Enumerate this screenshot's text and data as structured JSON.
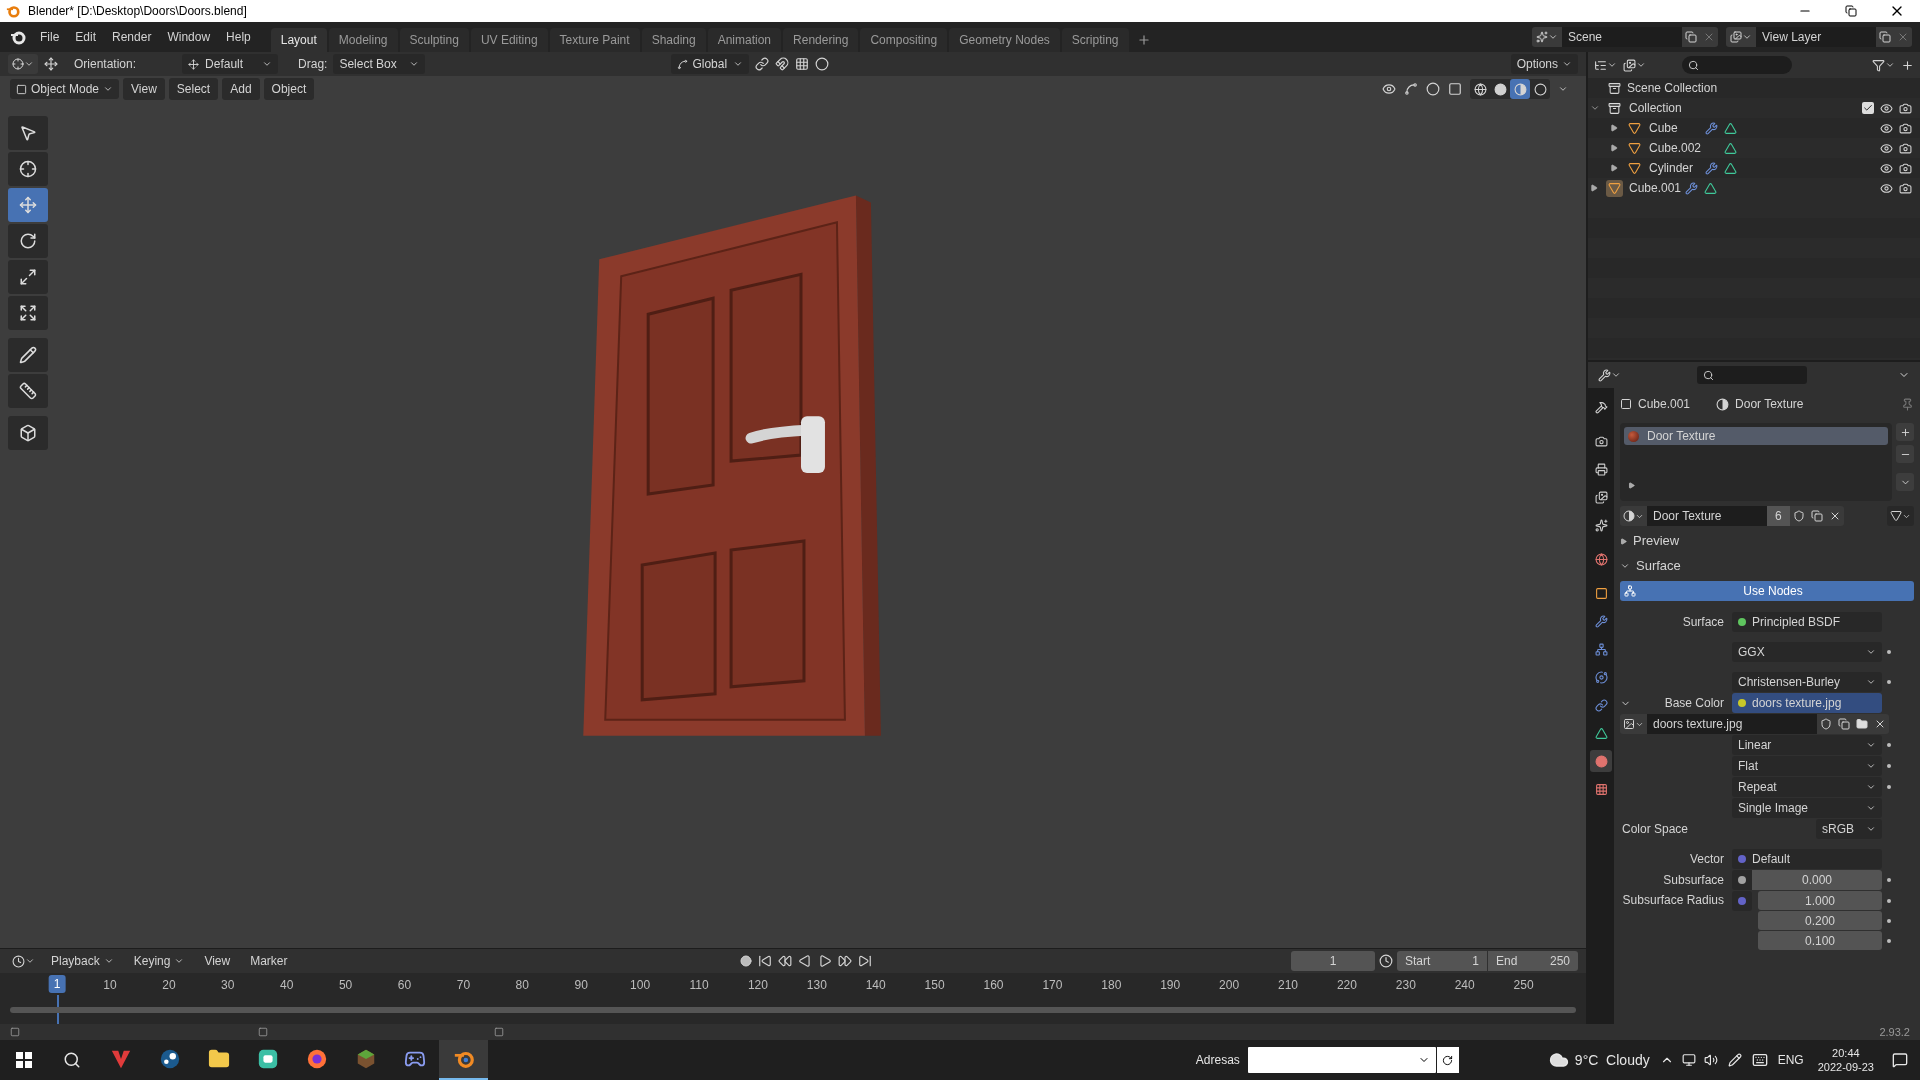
{
  "window": {
    "title": "Blender* [D:\\Desktop\\Doors\\Doors.blend]"
  },
  "menu": [
    "File",
    "Edit",
    "Render",
    "Window",
    "Help"
  ],
  "workspaces": [
    {
      "label": "Layout",
      "selected": true
    },
    {
      "label": "Modeling",
      "selected": false
    },
    {
      "label": "Sculpting",
      "selected": false
    },
    {
      "label": "UV Editing",
      "selected": false
    },
    {
      "label": "Texture Paint",
      "selected": false
    },
    {
      "label": "Shading",
      "selected": false
    },
    {
      "label": "Animation",
      "selected": false
    },
    {
      "label": "Rendering",
      "selected": false
    },
    {
      "label": "Compositing",
      "selected": false
    },
    {
      "label": "Geometry Nodes",
      "selected": false
    },
    {
      "label": "Scripting",
      "selected": false
    }
  ],
  "scene": "Scene",
  "view_layer": "View Layer",
  "tool_header": {
    "orientation_label": "Orientation:",
    "orientation": "Default",
    "drag_label": "Drag:",
    "drag": "Select Box",
    "transform": "Global",
    "options": "Options"
  },
  "viewport_header": {
    "mode": "Object Mode",
    "menus": [
      "View",
      "Select",
      "Add",
      "Object"
    ],
    "shading": [
      {
        "kind": "wireframe",
        "selected": false
      },
      {
        "kind": "solid",
        "selected": false
      },
      {
        "kind": "material",
        "selected": true
      },
      {
        "kind": "rendered",
        "selected": false
      }
    ]
  },
  "toolbar": [
    {
      "kind": "select",
      "selected": false
    },
    {
      "kind": "cursor",
      "selected": false
    },
    {
      "kind": "move",
      "selected": true
    },
    {
      "kind": "rotate",
      "selected": false
    },
    {
      "kind": "scale",
      "selected": false
    },
    {
      "kind": "transform",
      "selected": false
    },
    {
      "kind": "annotate",
      "selected": false
    },
    {
      "kind": "measure",
      "selected": false
    },
    {
      "kind": "add_cube",
      "selected": false
    }
  ],
  "outliner": {
    "root": "Scene Collection",
    "tree": [
      {
        "kind": "collection",
        "label": "Collection",
        "expanded": true,
        "checked": true,
        "selected": false,
        "children": [
          {
            "kind": "mesh",
            "label": "Cube",
            "expanded": false,
            "modifier": true,
            "selected": false
          },
          {
            "kind": "mesh",
            "label": "Cube.002",
            "expanded": false,
            "modifier": false,
            "selected": false
          },
          {
            "kind": "mesh",
            "label": "Cylinder",
            "expanded": false,
            "modifier": true,
            "selected": false
          }
        ]
      },
      {
        "kind": "mesh",
        "label": "Cube.001",
        "expanded": false,
        "modifier": true,
        "selected": true
      }
    ]
  },
  "properties": {
    "breadcrumb": [
      "Cube.001",
      "Door Texture"
    ],
    "tabs": [
      {
        "kind": "tool",
        "selected": false
      },
      {
        "kind": "render",
        "selected": false
      },
      {
        "kind": "output",
        "selected": false
      },
      {
        "kind": "view_layer",
        "selected": false
      },
      {
        "kind": "scene",
        "selected": false
      },
      {
        "kind": "world",
        "selected": false
      },
      {
        "kind": "object",
        "selected": false
      },
      {
        "kind": "modifiers",
        "selected": false
      },
      {
        "kind": "particles",
        "selected": false
      },
      {
        "kind": "physics",
        "selected": false
      },
      {
        "kind": "constraints",
        "selected": false
      },
      {
        "kind": "data",
        "selected": false
      },
      {
        "kind": "material",
        "selected": true
      },
      {
        "kind": "texture",
        "selected": false
      }
    ],
    "slots": [
      {
        "label": "Door Texture",
        "selected": true
      }
    ],
    "material": {
      "name": "Door Texture",
      "users": "6"
    },
    "panels": [
      {
        "label": "Preview",
        "expanded": false
      },
      {
        "label": "Surface",
        "expanded": true
      }
    ],
    "use_nodes": "Use Nodes",
    "rows": [
      {
        "kind": "link",
        "label": "Surface",
        "value": "Principled BSDF",
        "color": "#5fc55f",
        "expanded": false,
        "keyframe": false
      },
      {
        "kind": "dropdown",
        "value": "GGX",
        "keyframe": true
      },
      {
        "kind": "dropdown",
        "value": "Christensen-Burley",
        "keyframe": true
      },
      {
        "kind": "link",
        "label": "Base Color",
        "value": "doors texture.jpg",
        "color": "#c7c729",
        "expanded": true,
        "keyframe": false
      },
      {
        "kind": "image",
        "value": "doors texture.jpg",
        "keyframe": false
      },
      {
        "kind": "dropdown",
        "value": "Linear",
        "keyframe": true
      },
      {
        "kind": "dropdown",
        "value": "Flat",
        "keyframe": true
      },
      {
        "kind": "dropdown",
        "value": "Repeat",
        "keyframe": true
      },
      {
        "kind": "dropdown",
        "value": "Single Image",
        "keyframe": false
      },
      {
        "kind": "colorspace",
        "label": "Color Space",
        "value": "sRGB",
        "keyframe": false
      },
      {
        "kind": "link",
        "label": "Vector",
        "value": "Default",
        "color": "#6363c7",
        "expanded": false,
        "keyframe": false
      },
      {
        "kind": "number",
        "label": "Subsurface",
        "value": "0.000",
        "color": "#a1a1a1",
        "keyframe": true
      },
      {
        "kind": "vector",
        "label": "Subsurface Radius",
        "values": [
          "1.000",
          "0.200",
          "0.100"
        ],
        "color": "#6363c7",
        "keyframe": true
      }
    ]
  },
  "timeline": {
    "menus": [
      "Playback",
      "Keying",
      "View",
      "Marker"
    ],
    "frame": "1",
    "start_label": "Start",
    "start": "1",
    "end_label": "End",
    "end": "250",
    "current": "1",
    "ruler": [
      "10",
      "20",
      "30",
      "40",
      "50",
      "60",
      "70",
      "80",
      "90",
      "100",
      "110",
      "120",
      "130",
      "140",
      "150",
      "160",
      "170",
      "180",
      "190",
      "200",
      "210",
      "220",
      "230",
      "240",
      "250"
    ]
  },
  "version": "2.93.2",
  "taskbar": {
    "apps": [
      {
        "kind": "vivaldi",
        "selected": false
      },
      {
        "kind": "steam",
        "selected": false
      },
      {
        "kind": "explorer",
        "selected": false
      },
      {
        "kind": "chat",
        "selected": false
      },
      {
        "kind": "firefox",
        "selected": false
      },
      {
        "kind": "block",
        "selected": false
      },
      {
        "kind": "discord",
        "selected": false
      },
      {
        "kind": "blender",
        "selected": true
      }
    ],
    "address_label": "Adresas",
    "weather": "9°C  Cloudy",
    "language": "ENG",
    "time": "20:44",
    "date": "2022-09-23"
  }
}
